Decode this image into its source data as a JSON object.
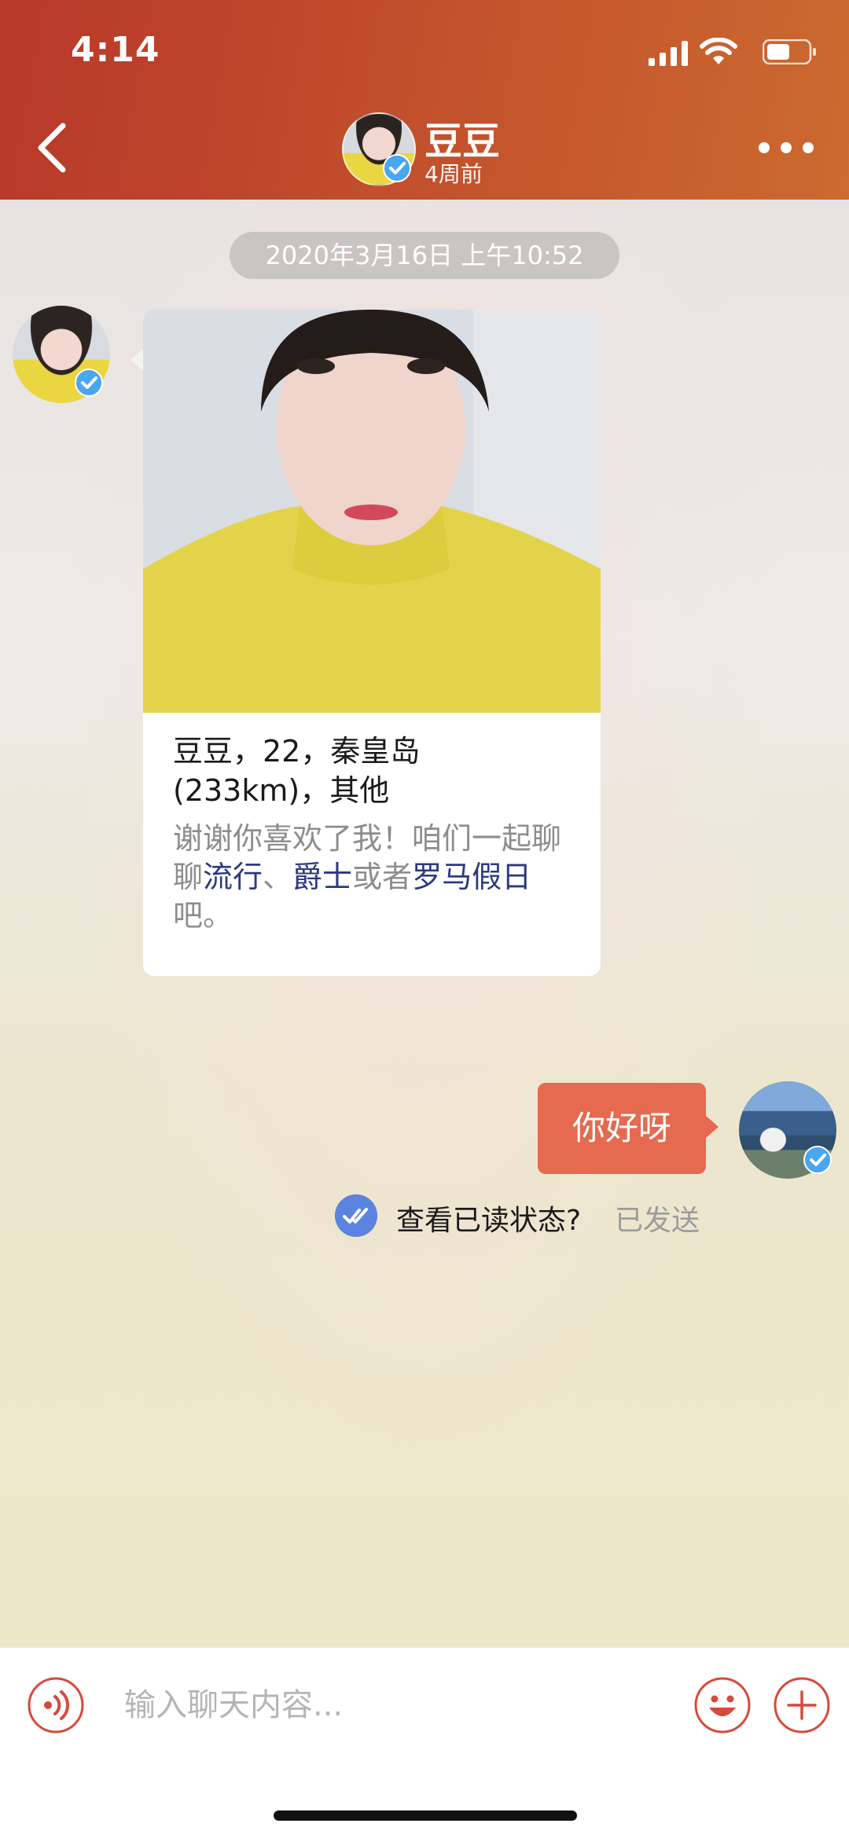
{
  "status_bar": {
    "time": "4:14"
  },
  "header": {
    "contact_name": "豆豆",
    "last_seen": "4周前"
  },
  "chat": {
    "date_separator": "2020年3月16日 上午10:52",
    "profile_card": {
      "info": "豆豆，22，秦皇岛(233km)，其他",
      "message_prefix": "谢谢你喜欢了我！咱们一起聊聊",
      "interest_1": "流行",
      "sep_1": "、",
      "interest_2": "爵士",
      "sep_2": "或者",
      "interest_3": "罗马假日",
      "message_suffix": "吧。"
    },
    "my_message": "你好呀",
    "read_prompt": "查看已读状态?",
    "send_status": "已发送"
  },
  "input_bar": {
    "placeholder": "输入聊天内容..."
  },
  "colors": {
    "header_start": "#b8382a",
    "header_end": "#cc6a30",
    "my_bubble": "#e56a4f",
    "accent_icon": "#d8493a",
    "link": "#2b3a80",
    "verified": "#4aa6f0",
    "read_check": "#5b83e0"
  },
  "icons": {
    "back": "chevron-left-icon",
    "more": "more-dots-icon",
    "verified": "verified-badge-icon",
    "voice": "voice-icon",
    "emoji": "emoji-icon",
    "plus": "plus-icon",
    "read": "double-check-icon"
  }
}
